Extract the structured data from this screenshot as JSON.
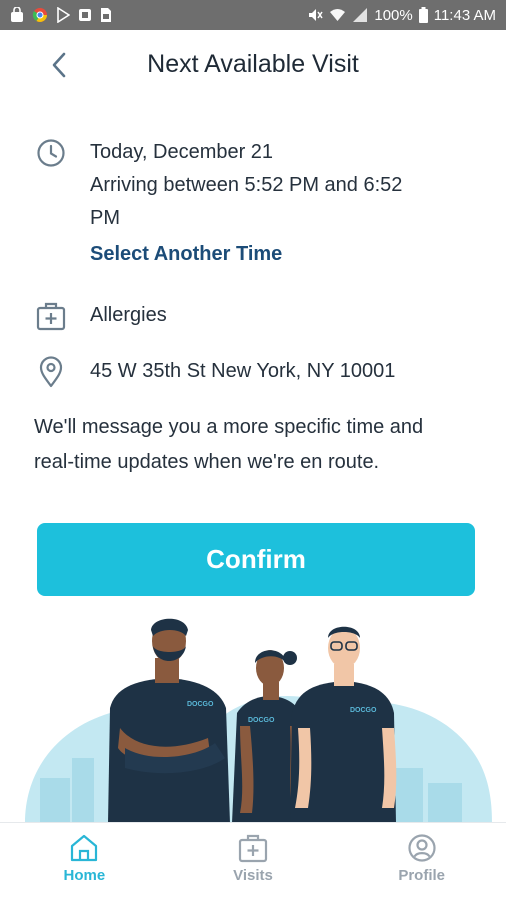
{
  "status_bar": {
    "battery": "100%",
    "time": "11:43 AM"
  },
  "header": {
    "title": "Next Available Visit"
  },
  "visit": {
    "date": "Today, December 21",
    "arrival_line1": "Arriving between 5:52 PM and 6:52",
    "arrival_line2": "PM",
    "select_time_label": "Select Another Time",
    "reason": "Allergies",
    "address": "45 W 35th St New York, NY 10001"
  },
  "message": {
    "line1": "We'll message you a more specific time and",
    "line2": "real-time updates when we're en route."
  },
  "confirm_label": "Confirm",
  "illustration": {
    "shirt_logo": "DOCGO"
  },
  "nav": {
    "items": [
      {
        "label": "Home",
        "icon": "home-icon",
        "active": true
      },
      {
        "label": "Visits",
        "icon": "medical-kit-icon",
        "active": false
      },
      {
        "label": "Profile",
        "icon": "profile-icon",
        "active": false
      }
    ]
  },
  "colors": {
    "accent": "#1dc0dc",
    "link": "#1c4c78",
    "nav_active": "#29b6d6",
    "nav_inactive": "#9aa4ae",
    "icon_gray": "#6b7d8c"
  }
}
